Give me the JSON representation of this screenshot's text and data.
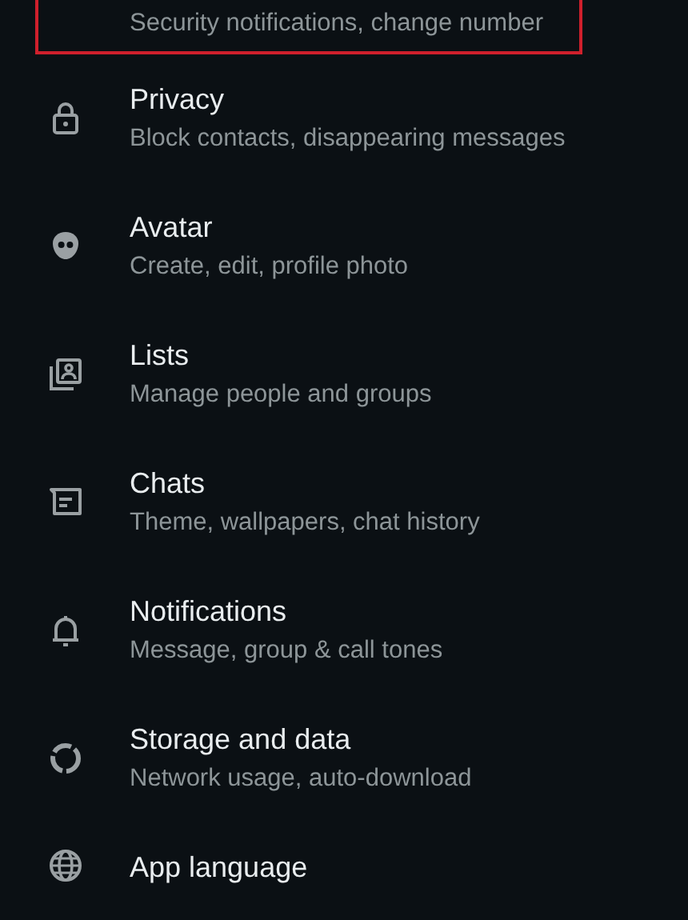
{
  "settings": [
    {
      "subtitle": "Security notifications, change number",
      "highlighted": true
    },
    {
      "kind": "lock",
      "title": "Privacy",
      "subtitle": "Block contacts, disappearing messages",
      "highlighted": false
    },
    {
      "kind": "avatar",
      "title": "Avatar",
      "subtitle": "Create, edit, profile photo",
      "highlighted": false
    },
    {
      "kind": "lists",
      "title": "Lists",
      "subtitle": "Manage people and groups",
      "highlighted": false
    },
    {
      "kind": "chats",
      "title": "Chats",
      "subtitle": "Theme, wallpapers, chat history",
      "highlighted": false
    },
    {
      "kind": "bell",
      "title": "Notifications",
      "subtitle": "Message, group & call tones",
      "highlighted": false
    },
    {
      "kind": "storage",
      "title": "Storage and data",
      "subtitle": "Network usage, auto-download",
      "highlighted": false
    },
    {
      "kind": "globe",
      "title": "App language",
      "highlighted": false
    }
  ]
}
